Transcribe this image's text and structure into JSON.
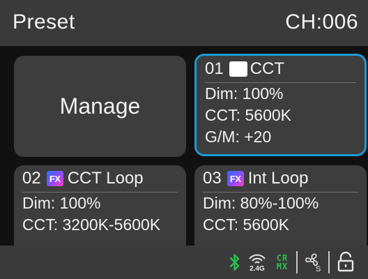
{
  "header": {
    "title": "Preset",
    "channel": "CH:006"
  },
  "manage": {
    "label": "Manage"
  },
  "presets": [
    {
      "number": "01",
      "icon": "white-swatch",
      "name": "CCT",
      "lines": [
        "Dim: 100%",
        "CCT: 5600K",
        "G/M: +20"
      ],
      "selected": true
    },
    {
      "number": "02",
      "icon": "fx",
      "icon_text": "FX",
      "name": "CCT Loop",
      "lines": [
        "Dim: 100%",
        "CCT: 3200K-5600K"
      ]
    },
    {
      "number": "03",
      "icon": "fx",
      "icon_text": "FX",
      "name": "Int Loop",
      "lines": [
        "Dim: 80%-100%",
        "CCT: 5600K"
      ]
    }
  ],
  "status": {
    "bluetooth_icon": "bluetooth-icon",
    "wireless_label": "2.4G",
    "crmx_top": "CR",
    "crmx_bottom": "MX",
    "fan_label": "S",
    "lock_icon": "lock-icon",
    "accent_green": "#2bbf4f",
    "selection_blue": "#1d9ad6"
  }
}
